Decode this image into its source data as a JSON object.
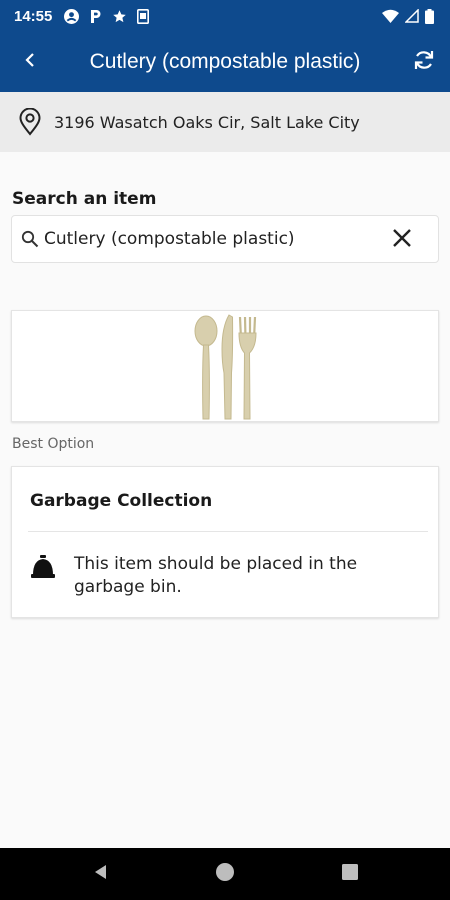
{
  "status_bar": {
    "time": "14:55",
    "icons_left": [
      "account-circle-icon",
      "parking-icon",
      "star-icon",
      "sim-card-icon"
    ],
    "icons_right": [
      "wifi-icon",
      "signal-icon",
      "battery-icon"
    ]
  },
  "app_bar": {
    "title": "Cutlery (compostable plastic)",
    "back_icon": "chevron-left-icon",
    "refresh_icon": "refresh-icon",
    "color": "#0e4a8d"
  },
  "location": {
    "address": "3196 Wasatch Oaks Cir, Salt Lake City",
    "icon": "location-pin-icon"
  },
  "search": {
    "label": "Search an item",
    "value": "Cutlery (compostable plastic)",
    "search_icon": "search-icon",
    "clear_icon": "close-icon"
  },
  "item_image": {
    "icon": "cutlery-icon"
  },
  "best_option": {
    "label": "Best Option"
  },
  "result": {
    "title": "Garbage Collection",
    "description": "This item should be placed in the garbage bin.",
    "icon": "garbage-bin-icon"
  },
  "nav_bar": {
    "back_icon": "nav-back-icon",
    "home_icon": "nav-home-icon",
    "recents_icon": "nav-recents-icon"
  }
}
